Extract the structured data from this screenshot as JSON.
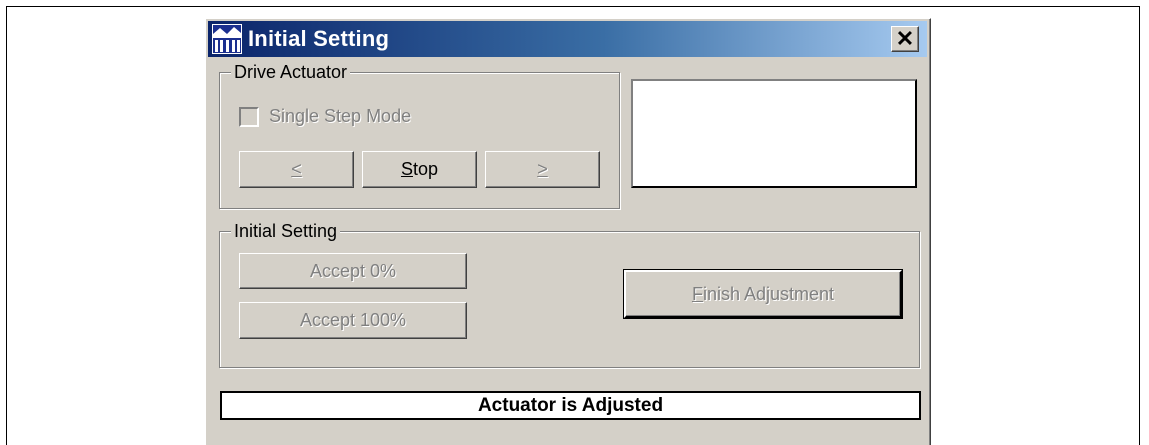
{
  "window": {
    "title": "Initial Setting",
    "close_label": "✕"
  },
  "drive_actuator": {
    "group_label": "Drive Actuator",
    "single_step_label": "Single Step Mode",
    "single_step_checked": false,
    "prev_button": {
      "prefix": "",
      "accel": "<",
      "suffix": ""
    },
    "stop_button": {
      "prefix": "",
      "accel": "S",
      "suffix": "top"
    },
    "next_button": {
      "prefix": "",
      "accel": ">",
      "suffix": ""
    }
  },
  "initial_setting": {
    "group_label": "Initial Setting",
    "accept0_label": "Accept 0%",
    "accept100_label": "Accept 100%",
    "finish_button": {
      "prefix": "",
      "accel": "F",
      "suffix": "inish Adjustment"
    }
  },
  "status": {
    "text": "Actuator is Adjusted"
  },
  "icons": {
    "app_icon": "app-logo-icon",
    "close_icon": "close-icon",
    "checkbox": "checkbox-unchecked"
  },
  "colors": {
    "titlebar_start": "#0a246a",
    "titlebar_end": "#a6caf0",
    "face": "#d4d0c8",
    "disabled_text": "#808080"
  }
}
